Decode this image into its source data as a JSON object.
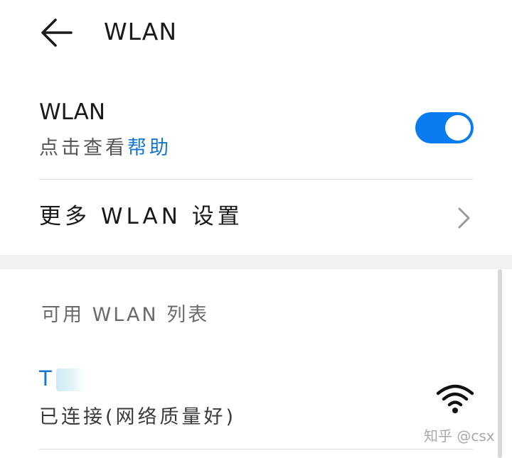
{
  "header": {
    "title": "WLAN",
    "back_icon": "arrow-left-icon"
  },
  "wlan_toggle": {
    "label": "WLAN",
    "subtitle_prefix": "点击查看",
    "help_link": "帮助",
    "enabled": true,
    "accent_color": "#0a7cf0"
  },
  "more_settings": {
    "label": "更多 WLAN 设置",
    "icon": "chevron-right-icon"
  },
  "available_list": {
    "header": "可用 WLAN 列表",
    "networks": [
      {
        "ssid": "T",
        "status": "已连接(网络质量好)",
        "signal_icon": "wifi-full-icon"
      }
    ]
  },
  "watermark": "知乎 @csx",
  "colors": {
    "link": "#1677d3",
    "divider": "#dcdcdc",
    "section_background": "#f1f1f1"
  }
}
